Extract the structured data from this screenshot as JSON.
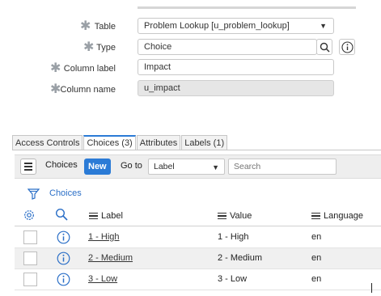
{
  "form": {
    "table": {
      "label": "Table",
      "value": "Problem Lookup [u_problem_lookup]"
    },
    "type": {
      "label": "Type",
      "value": "Choice"
    },
    "column_label": {
      "label": "Column label",
      "value": "Impact"
    },
    "column_name": {
      "label": "Column name",
      "value": "u_impact"
    },
    "required_marker": "✱"
  },
  "tabs": [
    {
      "label": "Access Controls",
      "active": false
    },
    {
      "label": "Choices (3)",
      "active": true
    },
    {
      "label": "Attributes",
      "active": false
    },
    {
      "label": "Labels (1)",
      "active": false
    }
  ],
  "toolbar": {
    "title": "Choices",
    "new_label": "New",
    "goto_label": "Go to",
    "goto_selected": "Label",
    "search_placeholder": "Search"
  },
  "breadcrumb": "Choices",
  "columns": [
    "Label",
    "Value",
    "Language"
  ],
  "rows": [
    {
      "label": "1 - High",
      "value": "1 - High",
      "language": "en"
    },
    {
      "label": "2 - Medium",
      "value": "2 - Medium",
      "language": "en"
    },
    {
      "label": "3 - Low",
      "value": "3 - Low",
      "language": "en"
    }
  ],
  "colors": {
    "accent": "#2b7bd6",
    "link": "#2b6fc7",
    "readonly_bg": "#e6e6e6"
  },
  "icons": [
    "search-icon",
    "info-icon",
    "chevron-down-icon",
    "menu-icon",
    "filter-icon",
    "gear-icon"
  ]
}
